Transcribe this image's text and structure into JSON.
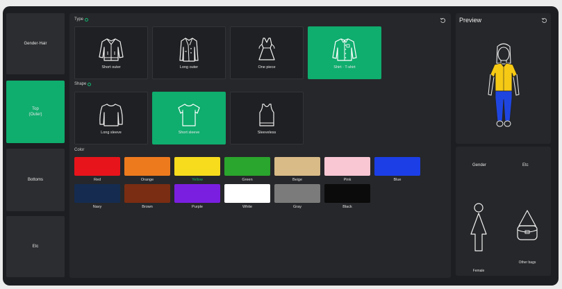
{
  "categories": [
    {
      "label": "Gender·Hair",
      "active": false
    },
    {
      "label": "Top",
      "sub": "(Outer)",
      "active": true
    },
    {
      "label": "Bottoms",
      "active": false
    },
    {
      "label": "Etc",
      "active": false
    }
  ],
  "main": {
    "type": {
      "label": "Type",
      "items": [
        {
          "label": "Short outer",
          "icon": "short-outer-icon"
        },
        {
          "label": "Long outer",
          "icon": "long-outer-icon"
        },
        {
          "label": "One piece",
          "icon": "one-piece-icon"
        },
        {
          "label": "Shirt · T-shirt",
          "icon": "shirt-icon",
          "selected": true
        }
      ]
    },
    "shape": {
      "label": "Shape",
      "items": [
        {
          "label": "Long sleeve",
          "icon": "long-sleeve-icon"
        },
        {
          "label": "Short sleeve",
          "icon": "short-sleeve-icon",
          "selected": true
        },
        {
          "label": "Sleeveless",
          "icon": "sleeveless-icon"
        }
      ]
    },
    "color": {
      "label": "Color",
      "swatches": [
        {
          "label": "Red",
          "hex": "#e8141b"
        },
        {
          "label": "Orange",
          "hex": "#ee7a1e"
        },
        {
          "label": "Yellow",
          "hex": "#f6dc1d",
          "selected": true
        },
        {
          "label": "Green",
          "hex": "#2aa52d"
        },
        {
          "label": "Beige",
          "hex": "#d8bb87"
        },
        {
          "label": "Pink",
          "hex": "#f9c7d3"
        },
        {
          "label": "Blue",
          "hex": "#1b3ee6"
        },
        {
          "label": "Navy",
          "hex": "#152c50"
        },
        {
          "label": "Brown",
          "hex": "#7a2d12"
        },
        {
          "label": "Purple",
          "hex": "#7a1fe0"
        },
        {
          "label": "White",
          "hex": "#ffffff"
        },
        {
          "label": "Gray",
          "hex": "#7b7b7b"
        },
        {
          "label": "Black",
          "hex": "#0b0b0b"
        }
      ]
    }
  },
  "preview": {
    "title": "Preview",
    "top_color": "#f6c914",
    "bottom_color": "#1f45e0"
  },
  "options": {
    "gender_heading": "Gender",
    "etc_heading": "Etc",
    "gender_value": "Female",
    "etc_value": "Other bags"
  },
  "colors": {
    "accent": "#0fad6e",
    "selected_label": "#16c06a"
  }
}
